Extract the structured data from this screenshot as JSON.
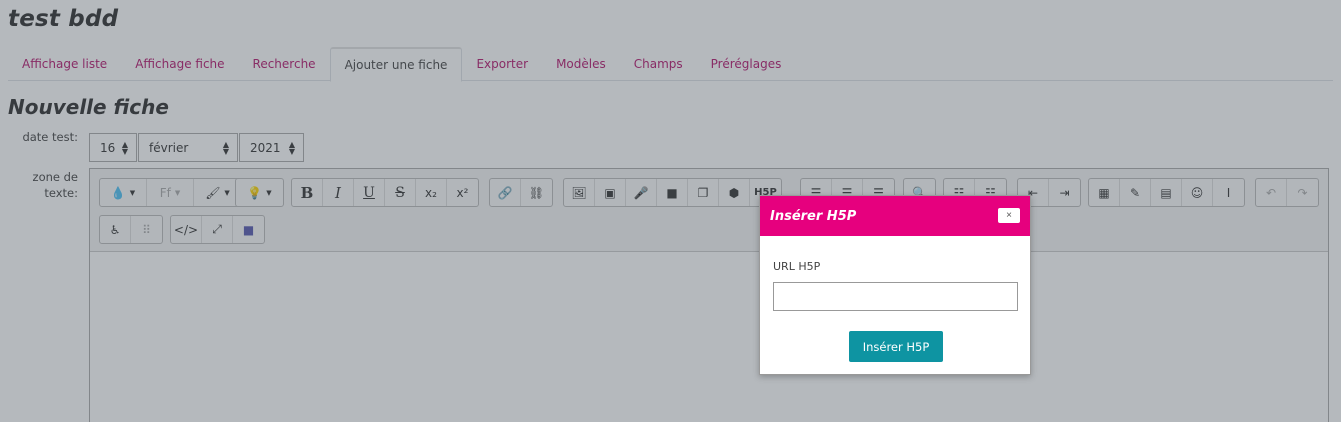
{
  "page": {
    "title": "test bdd"
  },
  "tabs": [
    {
      "label": "Affichage liste",
      "active": false
    },
    {
      "label": "Affichage fiche",
      "active": false
    },
    {
      "label": "Recherche",
      "active": false
    },
    {
      "label": "Ajouter une fiche",
      "active": true
    },
    {
      "label": "Exporter",
      "active": false
    },
    {
      "label": "Modèles",
      "active": false
    },
    {
      "label": "Champs",
      "active": false
    },
    {
      "label": "Préréglages",
      "active": false
    }
  ],
  "form": {
    "title": "Nouvelle fiche",
    "date_label": "date test:",
    "date": {
      "day": "16",
      "month": "février",
      "year": "2021"
    },
    "zone_label_line1": "zone de",
    "zone_label_line2": "texte:"
  },
  "toolbar": {
    "font_family_placeholder": "Ff",
    "bold": "B",
    "italic": "I",
    "underline": "U",
    "strikethrough": "S",
    "h5p": "H5P"
  },
  "modal": {
    "title": "Insérer H5P",
    "close": "×",
    "field_label": "URL H5P",
    "url_value": "",
    "submit_label": "Insérer H5P"
  },
  "colors": {
    "accent": "#e6007e",
    "tab_link": "#b5146d",
    "submit": "#0e94a2"
  }
}
